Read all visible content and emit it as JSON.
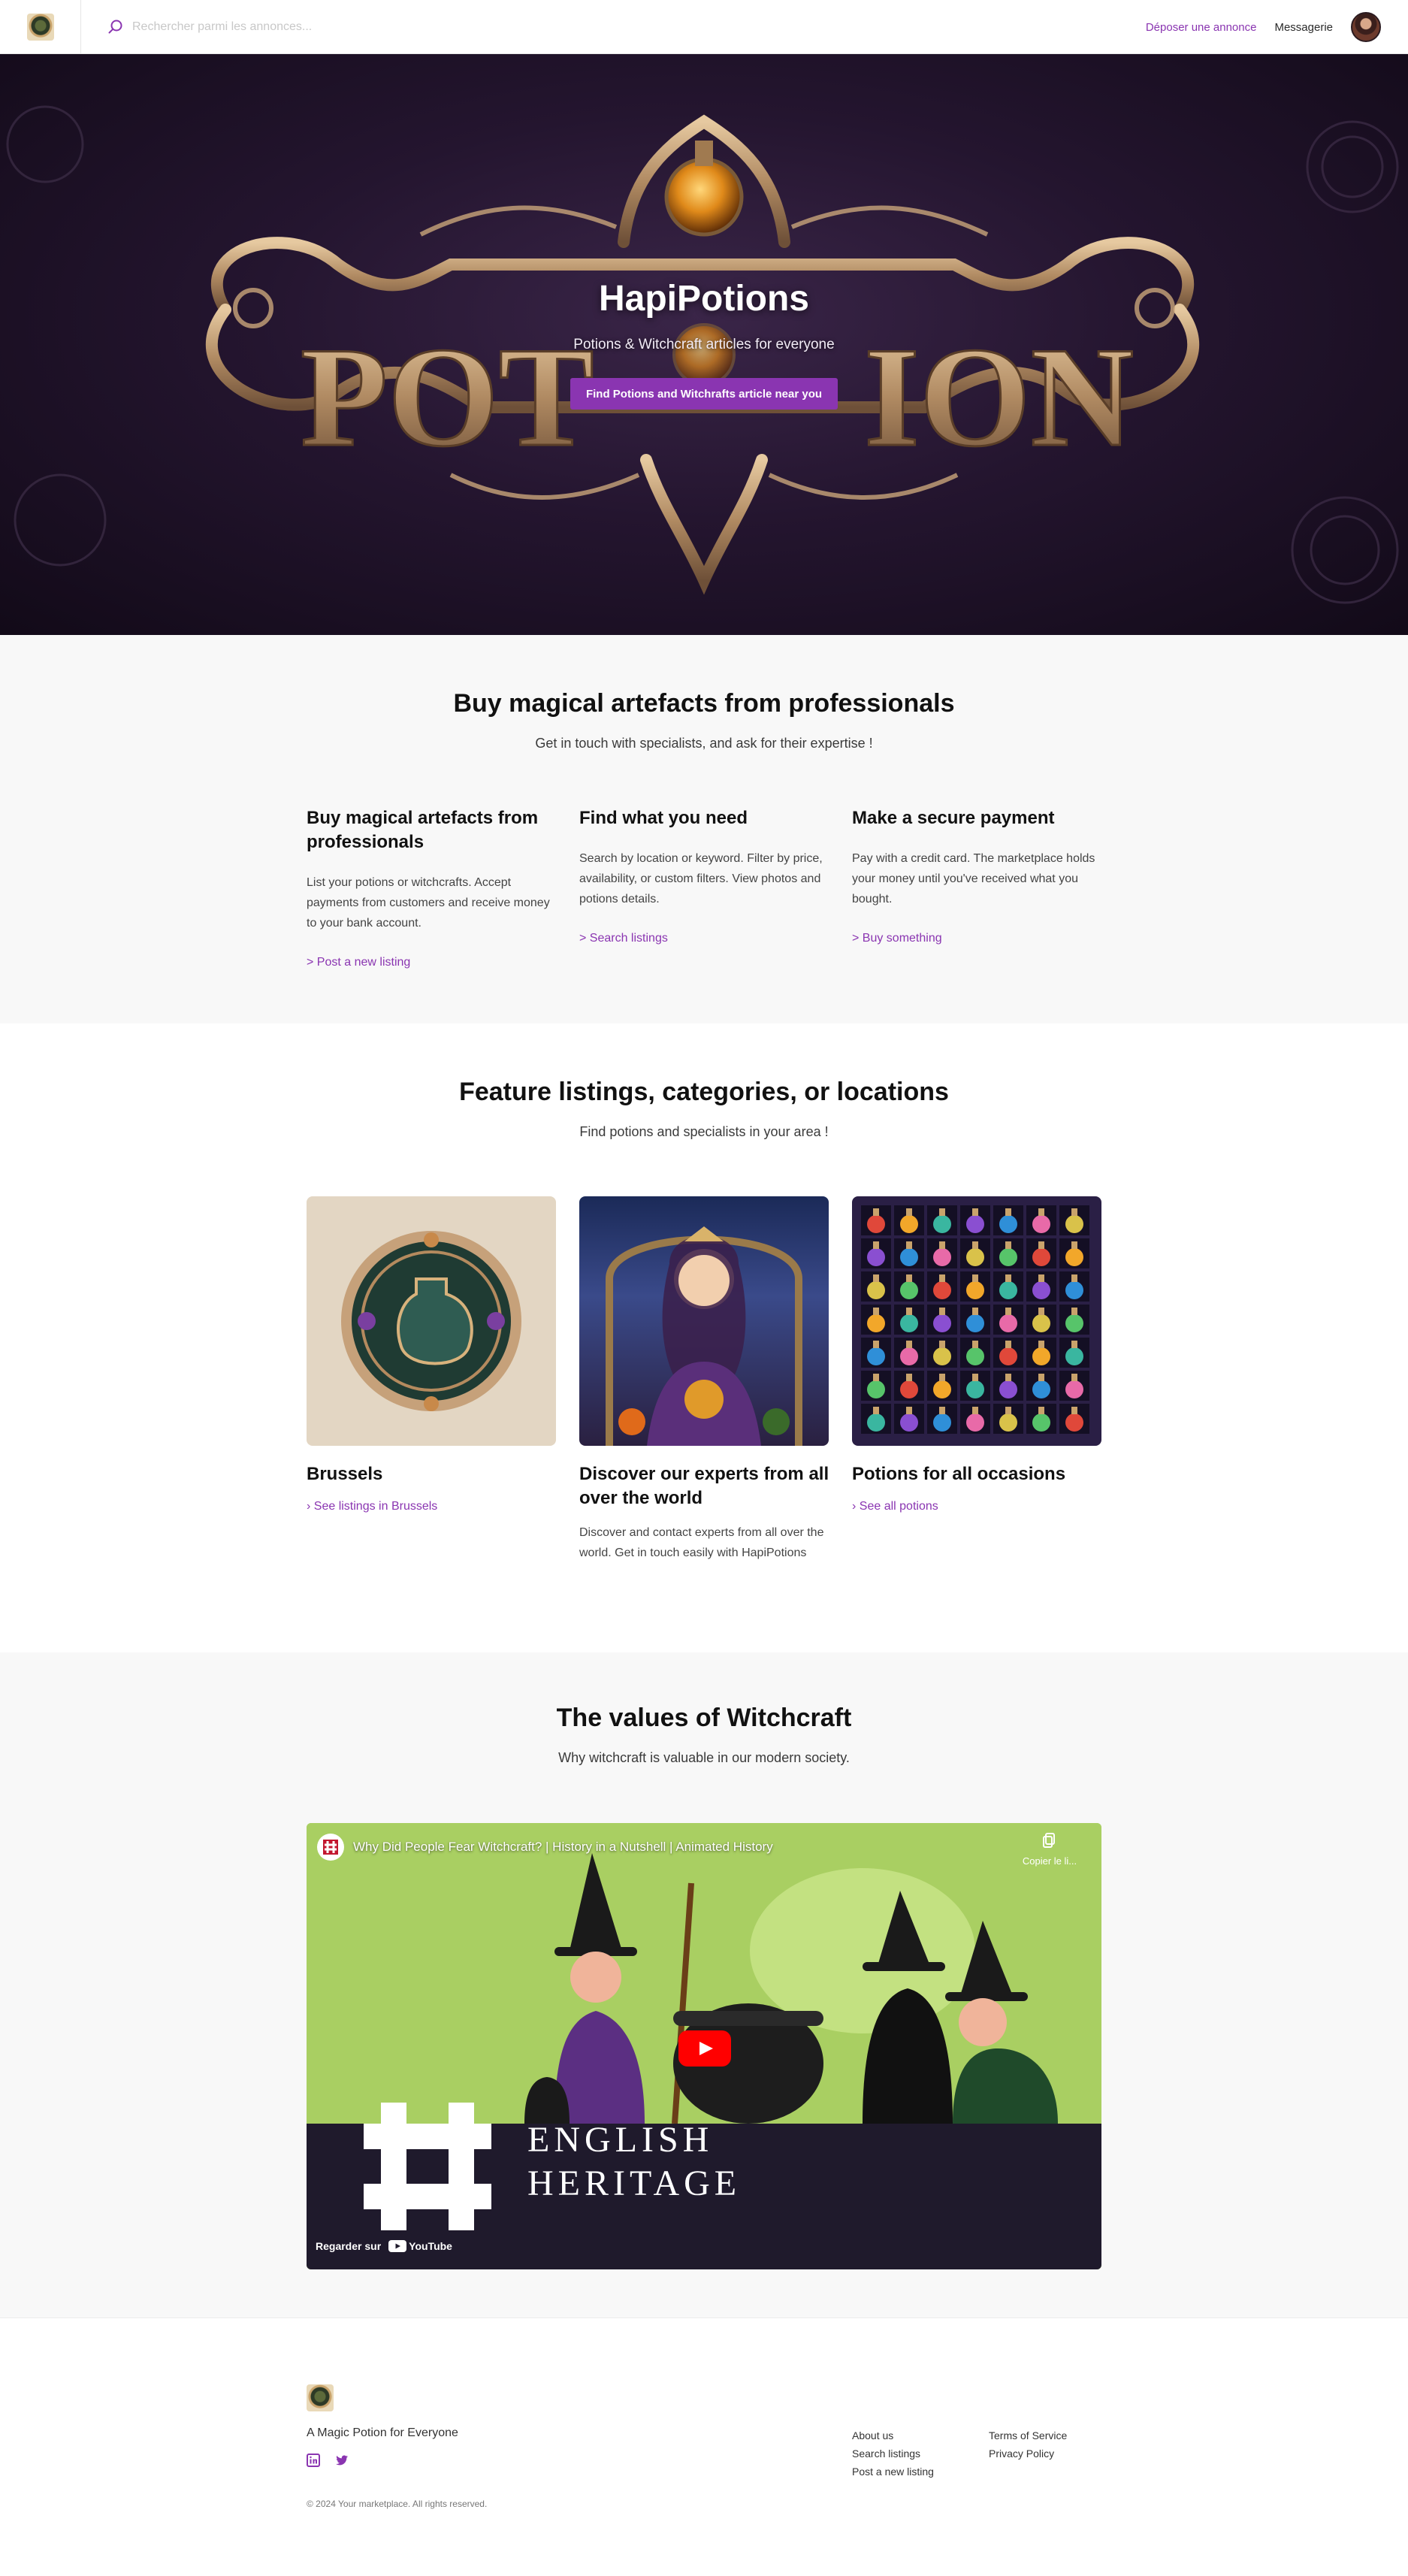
{
  "topbar": {
    "search_placeholder": "Rechercher parmi les annonces...",
    "post_listing": "Déposer une annonce",
    "messages": "Messagerie"
  },
  "hero": {
    "title": "HapiPotions",
    "subtitle": "Potions & Witchcraft articles for everyone",
    "cta": "Find Potions and Witchrafts article near you"
  },
  "how": {
    "title": "Buy magical artefacts from professionals",
    "subtitle": "Get in touch with specialists, and ask for their expertise !",
    "columns": [
      {
        "heading": "Buy magical artefacts from professionals",
        "text": "List your potions or witchcrafts. Accept payments from customers and receive money to your bank account.",
        "link": "> Post a new listing"
      },
      {
        "heading": "Find what you need",
        "text": "Search by location or keyword. Filter by price, availability, or custom filters. View photos and potions details.",
        "link": "> Search listings"
      },
      {
        "heading": "Make a secure payment",
        "text": "Pay with a credit card. The marketplace holds your money until you've received what you bought.",
        "link": "> Buy something"
      }
    ]
  },
  "features": {
    "title": "Feature listings, categories, or locations",
    "subtitle": "Find potions and specialists in your area !",
    "cards": [
      {
        "heading": "Brussels",
        "link": "› See listings in Brussels",
        "text": ""
      },
      {
        "heading": "Discover our experts from all over the world",
        "link": "",
        "text": "Discover and contact experts from all over the world. Get in touch easily with HapiPotions"
      },
      {
        "heading": "Potions for all occasions",
        "link": "› See all potions",
        "text": ""
      }
    ]
  },
  "values": {
    "title": "The values of Witchcraft",
    "subtitle": "Why witchcraft is valuable in our modern society.",
    "video": {
      "title": "Why Did People Fear Witchcraft? | History in a Nutshell | Animated History",
      "copy_link": "Copier le li...",
      "brand_line1": "ENGLISH",
      "brand_line2": "HERITAGE",
      "watch_on": "Regarder sur",
      "youtube": "YouTube"
    }
  },
  "footer": {
    "tagline": "A Magic Potion for Everyone",
    "copyright": "© 2024 Your marketplace. All rights reserved.",
    "links_col1": [
      "About us",
      "Search listings",
      "Post a new listing"
    ],
    "links_col2": [
      "Terms of Service",
      "Privacy Policy"
    ]
  },
  "colors": {
    "accent": "#8a35b1",
    "hero_bg": "#24152f",
    "section_gray": "#f8f8f8"
  },
  "icons": [
    "search-icon",
    "linkedin-icon",
    "twitter-icon",
    "copy-icon",
    "youtube-play-icon"
  ]
}
